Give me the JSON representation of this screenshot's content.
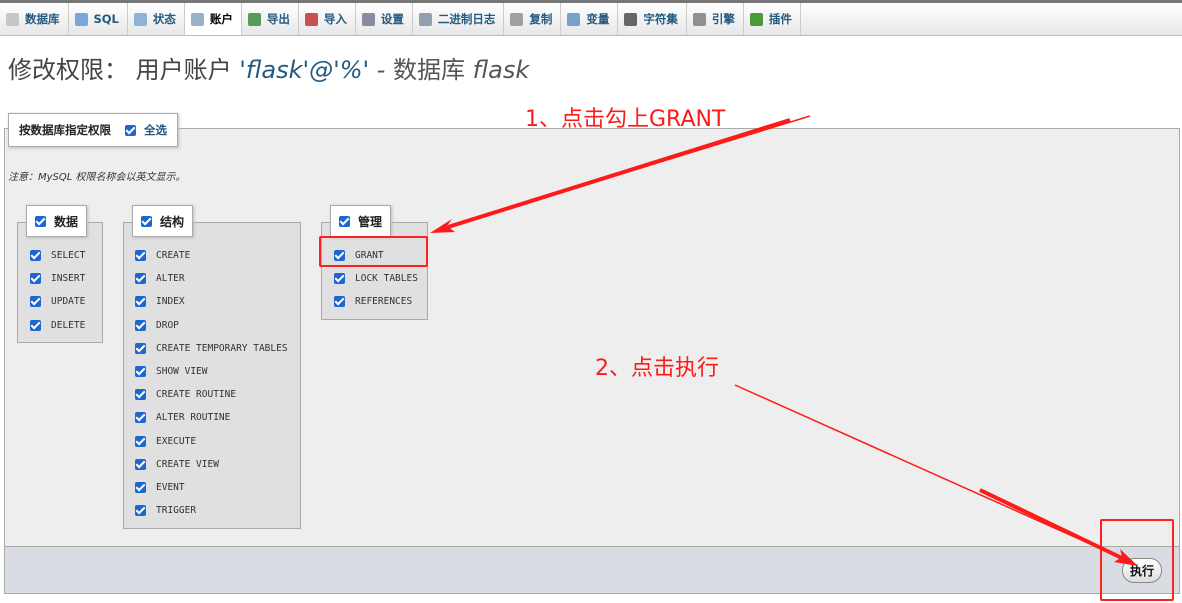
{
  "tabs": [
    {
      "label": "数据库",
      "icon": "database-icon",
      "color": "#c7c7c7"
    },
    {
      "label": "SQL",
      "icon": "sql-icon",
      "color": "#7aa7d8"
    },
    {
      "label": "状态",
      "icon": "status-icon",
      "color": "#8fb3d4"
    },
    {
      "label": "账户",
      "icon": "users-icon",
      "color": "#9bb0c8",
      "active": true
    },
    {
      "label": "导出",
      "icon": "export-icon",
      "color": "#5a9a5a"
    },
    {
      "label": "导入",
      "icon": "import-icon",
      "color": "#c85050"
    },
    {
      "label": "设置",
      "icon": "wrench-icon",
      "color": "#8a8aa0"
    },
    {
      "label": "二进制日志",
      "icon": "binlog-icon",
      "color": "#90a0b0"
    },
    {
      "label": "复制",
      "icon": "replication-icon",
      "color": "#a0a0a0"
    },
    {
      "label": "变量",
      "icon": "variables-icon",
      "color": "#7aa0c8"
    },
    {
      "label": "字符集",
      "icon": "charset-icon",
      "color": "#666666"
    },
    {
      "label": "引擎",
      "icon": "engine-icon",
      "color": "#909090"
    },
    {
      "label": "插件",
      "icon": "plugin-icon",
      "color": "#4a9a3a"
    }
  ],
  "title": {
    "prefix": "修改权限：",
    "user_label": "用户账户",
    "user": "'flask'@'%'",
    "sep": "- 数据库",
    "db": "flask"
  },
  "legend": {
    "label": "按数据库指定权限",
    "select_all": "全选"
  },
  "note": "注意：MySQL 权限名称会以英文显示。",
  "groups": {
    "data": {
      "title": "数据",
      "items": [
        "SELECT",
        "INSERT",
        "UPDATE",
        "DELETE"
      ]
    },
    "structure": {
      "title": "结构",
      "items": [
        "CREATE",
        "ALTER",
        "INDEX",
        "DROP",
        "CREATE TEMPORARY TABLES",
        "SHOW VIEW",
        "CREATE ROUTINE",
        "ALTER ROUTINE",
        "EXECUTE",
        "CREATE VIEW",
        "EVENT",
        "TRIGGER"
      ]
    },
    "admin": {
      "title": "管理",
      "items": [
        "GRANT",
        "LOCK TABLES",
        "REFERENCES"
      ]
    }
  },
  "go_button": "执行",
  "annotations": {
    "step1": "1、点击勾上GRANT",
    "step2": "2、点击执行",
    "color": "#ff1a1a"
  },
  "colors": {
    "accent": "#235a81",
    "checkbox": "#1e66d0"
  }
}
